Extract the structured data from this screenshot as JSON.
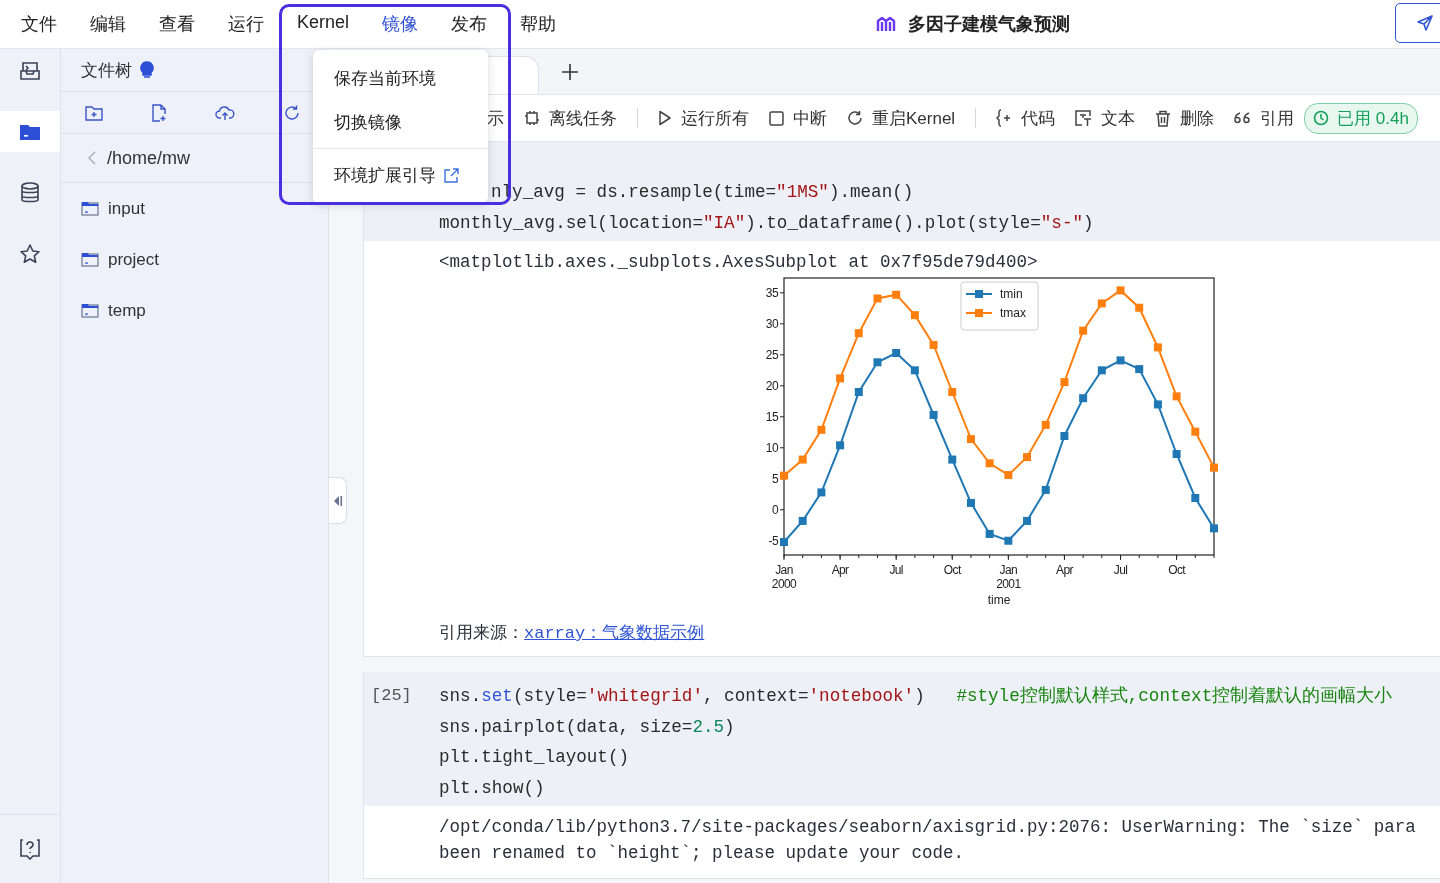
{
  "menubar": {
    "items": [
      {
        "label": "文件",
        "selected": false
      },
      {
        "label": "编辑",
        "selected": false
      },
      {
        "label": "查看",
        "selected": false
      },
      {
        "label": "运行",
        "selected": false
      },
      {
        "label": "Kernel",
        "selected": false
      },
      {
        "label": "镜像",
        "selected": true
      },
      {
        "label": "发布",
        "selected": false
      },
      {
        "label": "帮助",
        "selected": false
      }
    ],
    "title": "多因子建模气象预测"
  },
  "dropdown": {
    "items": [
      {
        "label": "保存当前环境",
        "kind": "action"
      },
      {
        "label": "切换镜像",
        "kind": "action"
      },
      {
        "label": "环境扩展引导",
        "kind": "external"
      }
    ]
  },
  "rail": {
    "items": [
      {
        "kind": "terminal",
        "selected": false
      },
      {
        "kind": "files",
        "selected": true
      },
      {
        "kind": "database",
        "selected": false
      },
      {
        "kind": "favorites",
        "selected": false
      }
    ]
  },
  "file_panel": {
    "title": "文件树",
    "path": "/home/mw",
    "items": [
      {
        "name": "input"
      },
      {
        "name": "project"
      },
      {
        "name": "temp"
      }
    ]
  },
  "toolbar": {
    "items": [
      {
        "kind": "display",
        "label": "示"
      },
      {
        "kind": "offline",
        "label": "离线任务"
      },
      {
        "kind": "divider"
      },
      {
        "kind": "run",
        "label": "运行所有"
      },
      {
        "kind": "stop",
        "label": "中断"
      },
      {
        "kind": "restart",
        "label": "重启Kernel"
      },
      {
        "kind": "divider"
      },
      {
        "kind": "code",
        "label": "代码"
      },
      {
        "kind": "text",
        "label": "文本"
      },
      {
        "kind": "delete",
        "label": "删除"
      },
      {
        "kind": "quote",
        "label": "引用"
      }
    ],
    "usage": "已用 0.4h"
  },
  "cells": [
    {
      "code": [
        {
          "covered": true,
          "tokens": [
            {
              "kind": "plain",
              "text": "nly_avg = ds.resample(time="
            },
            {
              "kind": "string",
              "text": "\"1MS\""
            },
            {
              "kind": "plain",
              "text": ").mean()"
            }
          ]
        },
        {
          "covered": false,
          "tokens": [
            {
              "kind": "plain",
              "text": "monthly_avg.sel(location="
            },
            {
              "kind": "string",
              "text": "\"IA\""
            },
            {
              "kind": "plain",
              "text": ").to_dataframe().plot(style="
            },
            {
              "kind": "string",
              "text": "\"s-\""
            },
            {
              "kind": "plain",
              "text": ")"
            }
          ]
        }
      ],
      "outputs": [
        {
          "kind": "text",
          "lines": [
            "<matplotlib.axes._subplots.AxesSubplot at 0x7f95de79d400>"
          ]
        },
        {
          "kind": "chart",
          "chart_data": {
            "type": "line",
            "xlabel": "time",
            "categories": [
              "Jan 2000",
              null,
              null,
              "Apr",
              null,
              null,
              "Jul",
              null,
              null,
              "Oct",
              null,
              null,
              "Jan 2001",
              null,
              null,
              "Apr",
              null,
              null,
              "Jul",
              null,
              null,
              "Oct",
              null,
              null
            ],
            "legend": true,
            "series": [
              {
                "name": "tmin",
                "color": "#1f77b4",
                "marker": "square",
                "values": [
                  -5.2,
                  -1.8,
                  2.8,
                  10.4,
                  19.0,
                  23.8,
                  25.3,
                  22.5,
                  15.3,
                  8.1,
                  1.1,
                  -3.9,
                  -5.0,
                  -1.8,
                  3.2,
                  11.9,
                  18.0,
                  22.5,
                  24.1,
                  22.7,
                  17.0,
                  9.0,
                  1.9,
                  -3.0
                ]
              },
              {
                "name": "tmax",
                "color": "#ff7f0e",
                "marker": "square",
                "values": [
                  5.5,
                  8.1,
                  12.9,
                  21.2,
                  28.5,
                  34.1,
                  34.7,
                  31.4,
                  26.6,
                  19.0,
                  11.4,
                  7.5,
                  5.6,
                  8.5,
                  13.7,
                  20.6,
                  28.9,
                  33.3,
                  35.4,
                  32.6,
                  26.2,
                  18.3,
                  12.6,
                  6.8
                ]
              }
            ],
            "ylim": [
              -7.3,
              37.4
            ],
            "yticks": [
              -5,
              0,
              5,
              10,
              15,
              20,
              25,
              30,
              35
            ]
          }
        },
        {
          "kind": "source",
          "label": "引用来源：",
          "link": "xarray：气象数据示例"
        }
      ]
    },
    {
      "prompt": "[25]",
      "code": [
        {
          "covered": false,
          "tokens": [
            {
              "kind": "plain",
              "text": "sns."
            },
            {
              "kind": "func",
              "text": "set"
            },
            {
              "kind": "plain",
              "text": "(style="
            },
            {
              "kind": "string",
              "text": "'whitegrid'"
            },
            {
              "kind": "plain",
              "text": ", context="
            },
            {
              "kind": "string",
              "text": "'notebook'"
            },
            {
              "kind": "plain",
              "text": ")   "
            },
            {
              "kind": "comment",
              "text": "#style控制默认样式,context控制着默认的画幅大小"
            }
          ]
        },
        {
          "covered": false,
          "tokens": [
            {
              "kind": "plain",
              "text": "sns.pairplot(data, size="
            },
            {
              "kind": "number",
              "text": "2.5"
            },
            {
              "kind": "plain",
              "text": ")"
            }
          ]
        },
        {
          "covered": false,
          "tokens": [
            {
              "kind": "plain",
              "text": "plt.tight_layout()"
            }
          ]
        },
        {
          "covered": false,
          "tokens": [
            {
              "kind": "plain",
              "text": "plt.show()"
            }
          ]
        }
      ],
      "outputs": [
        {
          "kind": "text",
          "lines": [
            "/opt/conda/lib/python3.7/site-packages/seaborn/axisgrid.py:2076: UserWarning: The `size` para",
            "been renamed to `height`; please update your code."
          ]
        }
      ]
    }
  ]
}
